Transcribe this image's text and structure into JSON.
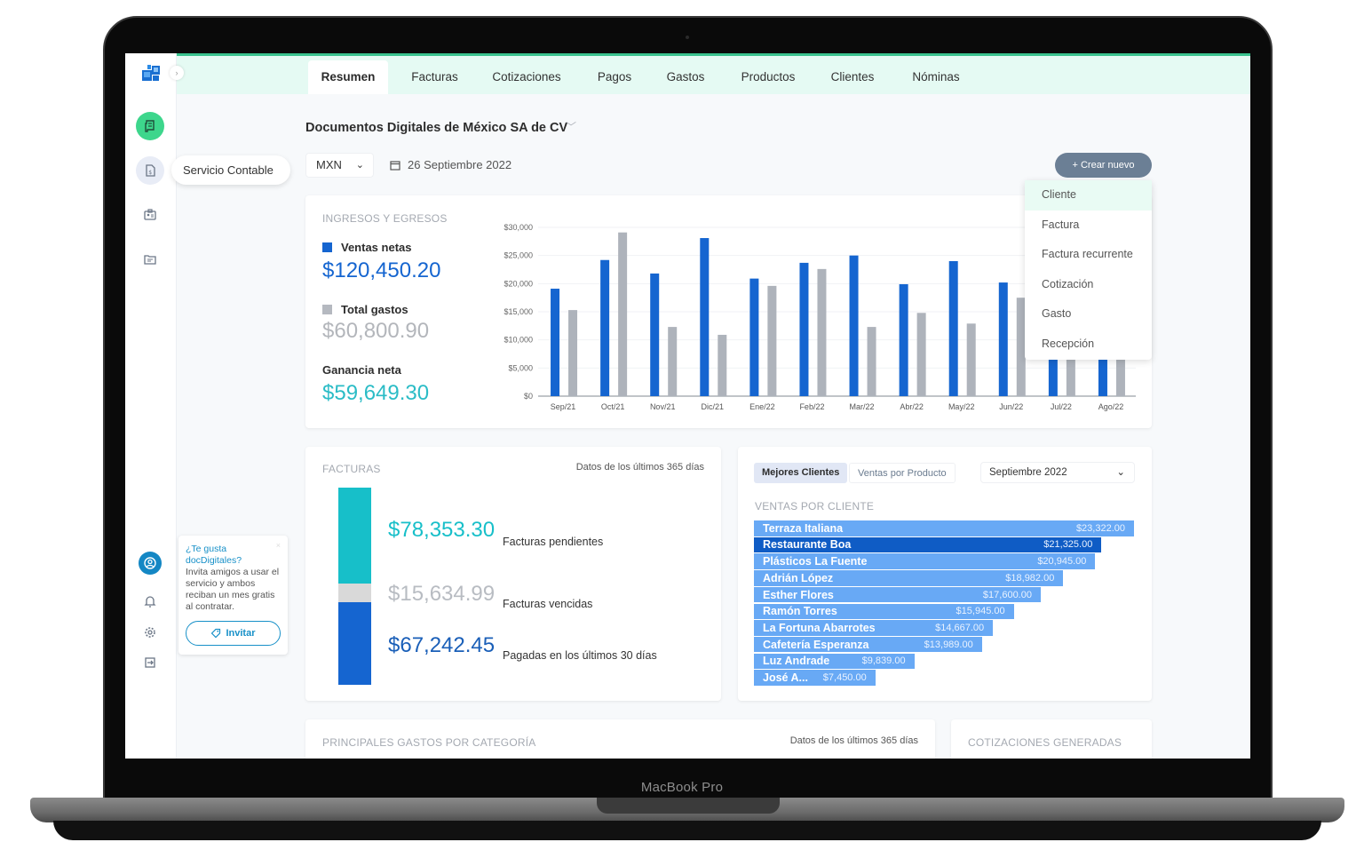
{
  "device": {
    "label": "MacBook Pro"
  },
  "sidebar": {
    "tooltip": "Servicio Contable",
    "items": [
      {
        "icon": "receipt-icon",
        "state": "active"
      },
      {
        "icon": "accounting-document-icon",
        "state": "hover"
      },
      {
        "icon": "id-badge-icon",
        "state": "normal"
      },
      {
        "icon": "folder-icon",
        "state": "normal"
      }
    ],
    "bottom_items": [
      "user-icon",
      "bell-icon",
      "gear-icon",
      "logout-icon"
    ],
    "invite": {
      "title": "¿Te gusta docDigitales?",
      "text": "Invita amigos a usar el servicio y ambos reciban un mes gratis al contratar.",
      "button": "Invitar",
      "close": "×"
    }
  },
  "nav": {
    "tabs": [
      "Resumen",
      "Facturas",
      "Cotizaciones",
      "Pagos",
      "Gastos",
      "Productos",
      "Clientes",
      "Nóminas"
    ],
    "active": "Resumen"
  },
  "header": {
    "company": "Documentos Digitales de México SA de CV",
    "currency": "MXN",
    "date": "26 Septiembre 2022",
    "create_button": "+ Crear nuevo",
    "create_menu": [
      "Cliente",
      "Factura",
      "Factura recurrente",
      "Cotización",
      "Gasto",
      "Recepción"
    ],
    "create_menu_highlighted": "Cliente"
  },
  "ingresos": {
    "title": "INGRESOS Y EGRESOS",
    "ventas_label": "Ventas netas",
    "ventas_value": "$120,450.20",
    "gastos_label": "Total gastos",
    "gastos_value": "$60,800.90",
    "ganancia_label": "Ganancia neta",
    "ganancia_value": "$59,649.30"
  },
  "facturas": {
    "title": "FACTURAS",
    "note": "Datos de los últimos 365 días",
    "items": [
      {
        "value": "$78,353.30",
        "label": "Facturas pendientes",
        "amount": 78353.3,
        "color": "#17bfc9"
      },
      {
        "value": "$15,634.99",
        "label": "Facturas vencidas",
        "amount": 15634.99,
        "color": "#d9d9d9"
      },
      {
        "value": "$67,242.45",
        "label": "Pagadas en los últimos 30 días",
        "amount": 67242.45,
        "color": "#1565d0"
      }
    ]
  },
  "clientes": {
    "tabs": [
      "Mejores Clientes",
      "Ventas por Producto"
    ],
    "active_tab": "Mejores Clientes",
    "month": "Septiembre 2022",
    "title": "VENTAS POR CLIENTE"
  },
  "bottom": {
    "gastos_title": "PRINCIPALES GASTOS POR CATEGORÍA",
    "gastos_note": "Datos de los últimos 365 días",
    "cotizaciones_title": "COTIZACIONES GENERADAS"
  },
  "colors": {
    "brand_green": "#3dd68c",
    "nav_bg": "#e5faf3",
    "sales_blue": "#1565d0",
    "expense_gray": "#aeb3bb",
    "profit_teal": "#2bbcc6",
    "client_bar": "#68a9f5",
    "client_bar_active": "#0f5cc5"
  },
  "chart_data": [
    {
      "type": "bar",
      "title": "INGRESOS Y EGRESOS",
      "categories": [
        "Sep/21",
        "Oct/21",
        "Nov/21",
        "Dic/21",
        "Ene/22",
        "Feb/22",
        "Mar/22",
        "Abr/22",
        "May/22",
        "Jun/22",
        "Jul/22",
        "Ago/22"
      ],
      "series": [
        {
          "name": "Ventas netas",
          "color": "#1565d0",
          "values": [
            19100,
            24200,
            21800,
            28100,
            20900,
            23700,
            25000,
            19900,
            24000,
            20200,
            12000,
            14000
          ]
        },
        {
          "name": "Total gastos",
          "color": "#aeb3bb",
          "values": [
            15300,
            29100,
            12300,
            10900,
            19600,
            22600,
            12300,
            14800,
            12900,
            17500,
            11000,
            13000
          ]
        }
      ],
      "yticks": [
        "$0",
        "$5,000",
        "$10,000",
        "$15,000",
        "$20,000",
        "$25,000",
        "$30,000"
      ],
      "ylim": [
        0,
        30000
      ],
      "grid": true,
      "xlabel": "",
      "ylabel": ""
    },
    {
      "type": "bar",
      "orientation": "horizontal",
      "title": "VENTAS POR CLIENTE",
      "categories": [
        "Terraza Italiana",
        "Restaurante Boa",
        "Plásticos La Fuente",
        "Adrián López",
        "Esther Flores",
        "Ramón Torres",
        "La Fortuna Abarrotes",
        "Cafetería Esperanza",
        "Luz Andrade",
        "José A..."
      ],
      "values": [
        23322,
        21325,
        20945,
        18982,
        17600,
        15945,
        14667,
        13989,
        9839,
        7450
      ],
      "labels": [
        "$23,322.00",
        "$21,325.00",
        "$20,945.00",
        "$18,982.00",
        "$17,600.00",
        "$15,945.00",
        "$14,667.00",
        "$13,989.00",
        "$9,839.00",
        "$7,450.00"
      ],
      "highlighted": "Restaurante Boa"
    }
  ]
}
